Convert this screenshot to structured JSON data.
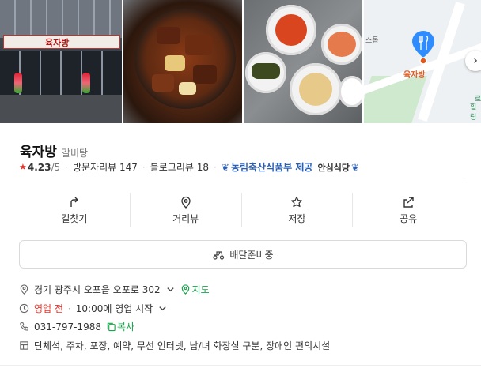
{
  "photos": {
    "storefront_sign": "육자방",
    "map_place_label": "육자방",
    "map_text_1": "스톱",
    "map_text_2": "로",
    "map_text_3": "힐링"
  },
  "place": {
    "name": "육자방",
    "category": "갈비탕"
  },
  "meta": {
    "rating": "4.23",
    "rating_max": "/5",
    "visitor_reviews": "방문자리뷰 147",
    "blog_reviews": "블로그리뷰 18",
    "badge": "농림축산식품부 제공",
    "badge_sub": "안심식당"
  },
  "actions": [
    {
      "label": "길찾기",
      "icon": "directions-icon"
    },
    {
      "label": "거리뷰",
      "icon": "street-view-icon"
    },
    {
      "label": "저장",
      "icon": "star-icon"
    },
    {
      "label": "공유",
      "icon": "share-icon"
    }
  ],
  "delivery": {
    "label": "배달준비중"
  },
  "info": {
    "address": "경기 광주시 오포읍 오포로 302",
    "map_link": "지도",
    "status": "영업 전",
    "hours": "10:00에 영업 시작",
    "phone": "031-797-1988",
    "copy": "복사",
    "amenities": "단체석, 주차, 포장, 예약, 무선 인터넷, 남/녀 화장실 구분, 장애인 편의시설"
  },
  "colors": {
    "accent_green": "#16a34a",
    "accent_red": "#e8332a",
    "map_pin": "#2f8cff"
  }
}
